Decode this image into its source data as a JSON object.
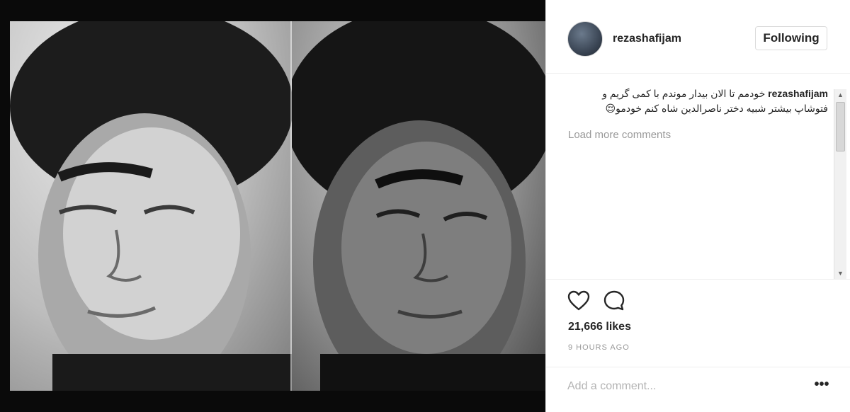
{
  "post": {
    "username": "rezashafijam",
    "follow_label": "Following",
    "caption_user": "rezashafijam",
    "caption_text": "خودمم تا الان بیدار موندم با کمی گریم و فتوشاپ بیشتر شبیه دختر ناصرالدین شاه کنم خودمو😌",
    "load_more": "Load more comments",
    "likes": "21,666 likes",
    "time": "9 HOURS AGO",
    "comment_placeholder": "Add a comment...",
    "more_label": "•••"
  },
  "scrollbar": {
    "up_arrow": "▲",
    "down_arrow": "▼"
  },
  "icons": {
    "like": "heart-outline-icon",
    "comment": "speech-bubble-icon",
    "more": "ellipsis-icon"
  },
  "colors": {
    "text": "#262626",
    "muted": "#999999",
    "border": "#dbdbdb"
  }
}
